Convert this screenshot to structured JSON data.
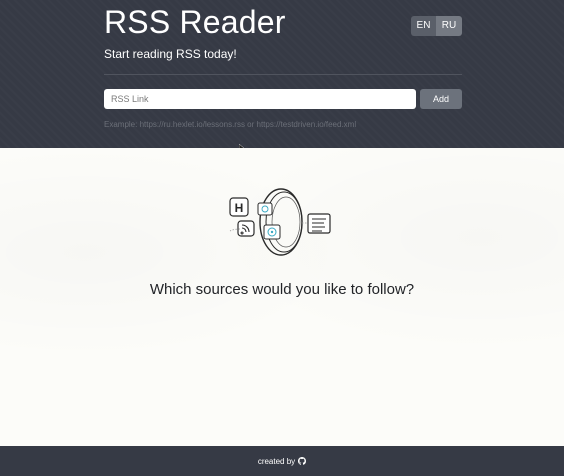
{
  "header": {
    "title": "RSS Reader",
    "subtitle": "Start reading RSS today!",
    "languages": [
      {
        "label": "EN",
        "active": false
      },
      {
        "label": "RU",
        "active": true
      }
    ]
  },
  "form": {
    "input_placeholder": "RSS Link",
    "input_value": "",
    "add_label": "Add",
    "example": "Example: https://ru.hexlet.io/lessons.rss or https://testdriven.io/feed.xml"
  },
  "main": {
    "question": "Which sources would you like to follow?",
    "illustration_icon": "rss-feeds-illustration"
  },
  "footer": {
    "created_by": "created by",
    "icon": "github-icon"
  },
  "colors": {
    "header_bg": "#363a45",
    "page_bg": "#fcfcf9",
    "button_bg": "#6c727c",
    "accent_cyan": "#39a9c2"
  }
}
